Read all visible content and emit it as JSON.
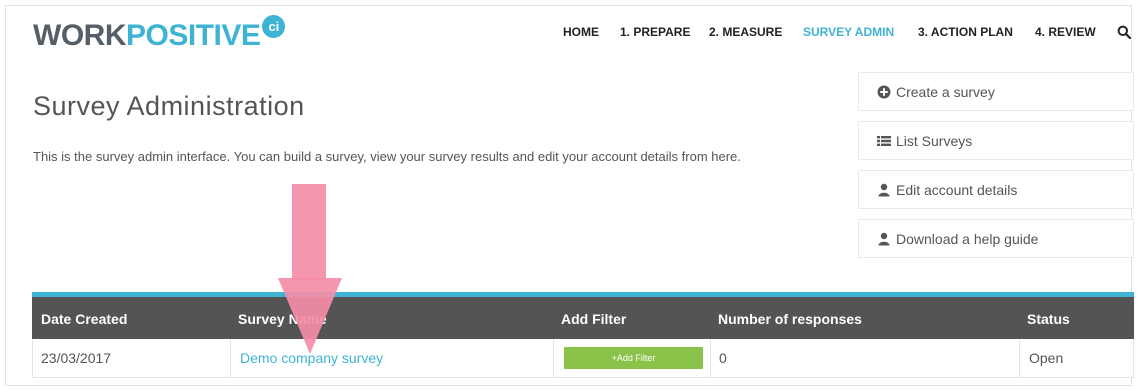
{
  "brand": {
    "word1": "WORK",
    "word2": "POSITIVE",
    "badge": "ci",
    "primary": "#3eb3d4",
    "dark": "#555e66"
  },
  "nav": {
    "items": [
      "HOME",
      "1. PREPARE",
      "2. MEASURE",
      "SURVEY ADMIN",
      "3. ACTION PLAN",
      "4. REVIEW"
    ],
    "active": "SURVEY ADMIN"
  },
  "page": {
    "title": "Survey Administration",
    "intro": "This is the survey admin interface. You can build a survey, view your survey results and edit your account details from here."
  },
  "sidebar": {
    "buttons": [
      {
        "label": "Create a survey",
        "icon": "plus-circle-icon"
      },
      {
        "label": "List Surveys",
        "icon": "list-icon"
      },
      {
        "label": "Edit account details",
        "icon": "user-icon"
      },
      {
        "label": "Download a help guide",
        "icon": "user-icon"
      }
    ]
  },
  "table": {
    "headers": [
      "Date Created",
      "Survey Name",
      "Add Filter",
      "Number of responses",
      "Status"
    ],
    "rows": [
      {
        "date": "23/03/2017",
        "name": "Demo company survey",
        "filter_button": "+Add Filter",
        "responses": "0",
        "status": "Open"
      }
    ]
  },
  "colors": {
    "header_bg": "#545454",
    "accent": "#3eb3d4",
    "filter_green": "#8bc34a",
    "arrow": "#f58da7"
  }
}
